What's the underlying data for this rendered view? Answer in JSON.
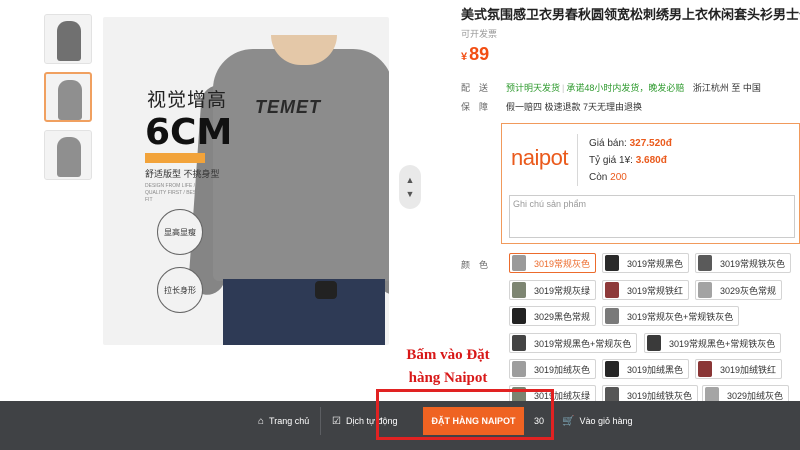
{
  "product": {
    "title": "美式氛围感卫衣男春秋圆领宽松刺绣男上衣休闲套头衫男士长",
    "invoice": "可开发票",
    "price_symbol": "¥",
    "price": "89",
    "shipping_label": "配送",
    "shipping_promise": "预计明天发货",
    "shipping_separator": "|",
    "shipping_commit": "承诺48小时内发货，晚发必赔",
    "shipping_route": "浙江杭州 至 中国",
    "guarantee_label": "保障",
    "guarantee_text": "假一赔四 极速退款 7天无理由退换"
  },
  "promo": {
    "headline": "视觉增高",
    "big_text": "6CM",
    "sub_text": "舒适版型 不挑身型",
    "fine_print": "DESIGN FROM LIFE / QUALITY FIRST / BEST FIT",
    "badge_1": "显高显瘦",
    "badge_2": "拉长身形",
    "shirt_logo": "TEMET"
  },
  "naipot": {
    "logo": "naipot",
    "sell_price_label": "Giá bán:",
    "sell_price": "327.520đ",
    "rate_label": "Tỷ giá 1¥:",
    "rate": "3.680đ",
    "remaining_label": "Còn",
    "remaining": "200",
    "note_placeholder": "Ghi chú sản phẩm"
  },
  "colors": {
    "label": "颜色",
    "options": [
      {
        "label": "3019常规灰色",
        "swatch": "#9a9a9a",
        "selected": true
      },
      {
        "label": "3019常规黑色",
        "swatch": "#2a2a2a",
        "selected": false
      },
      {
        "label": "3019常规铁灰色",
        "swatch": "#5a5a5a",
        "selected": false
      },
      {
        "label": "3019常规灰绿",
        "swatch": "#7d8572",
        "selected": false
      },
      {
        "label": "3019常规铁红",
        "swatch": "#8e3a3a",
        "selected": false
      },
      {
        "label": "3029灰色常规",
        "swatch": "#a3a3a3",
        "selected": false
      },
      {
        "label": "3029黑色常规",
        "swatch": "#222222",
        "selected": false
      },
      {
        "label": "3019常规灰色+常规铁灰色",
        "swatch": "#7a7a7a",
        "selected": false
      },
      {
        "label": "3019常规黑色+常规灰色",
        "swatch": "#444444",
        "selected": false
      },
      {
        "label": "3019常规黑色+常规铁灰色",
        "swatch": "#3a3a3a",
        "selected": false
      },
      {
        "label": "3019加绒灰色",
        "swatch": "#9d9d9d",
        "selected": false
      },
      {
        "label": "3019加绒黑色",
        "swatch": "#262626",
        "selected": false
      },
      {
        "label": "3019加绒铁红",
        "swatch": "#8a3636",
        "selected": false
      },
      {
        "label": "3019加绒灰绿",
        "swatch": "#7b8370",
        "selected": false
      },
      {
        "label": "3019加绒铁灰色",
        "swatch": "#575757",
        "selected": false
      },
      {
        "label": "3029加绒灰色",
        "swatch": "#a5a5a5",
        "selected": false
      }
    ]
  },
  "annotation": {
    "line1": "Bấm  vào Đặt",
    "line2": "hàng Naipot"
  },
  "bottom_bar": {
    "home": "Trang chủ",
    "translate": "Dịch tự động",
    "order": "ĐẶT HÀNG NAIPOT",
    "cart_hidden": "30",
    "add_cart": "Vào giỏ hàng"
  },
  "icons": {
    "home": "home-icon",
    "translate": "checkbox-icon",
    "cart": "cart-icon"
  },
  "accent_color": "#ef6322"
}
